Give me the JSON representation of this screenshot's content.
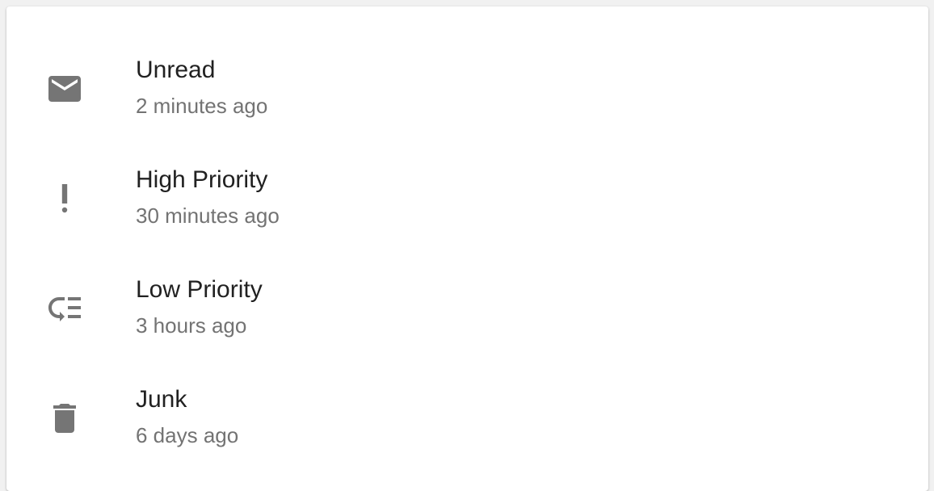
{
  "colors": {
    "icon": "#757575",
    "primary_text": "#212121",
    "secondary_text": "#737373",
    "card_background": "#ffffff"
  },
  "list": {
    "items": [
      {
        "icon": "mail-icon",
        "title": "Unread",
        "subtitle": "2 minutes ago"
      },
      {
        "icon": "priority-high-icon",
        "title": "High Priority",
        "subtitle": "30 minutes ago"
      },
      {
        "icon": "low-priority-icon",
        "title": "Low Priority",
        "subtitle": "3 hours ago"
      },
      {
        "icon": "delete-icon",
        "title": "Junk",
        "subtitle": "6 days ago"
      }
    ]
  }
}
